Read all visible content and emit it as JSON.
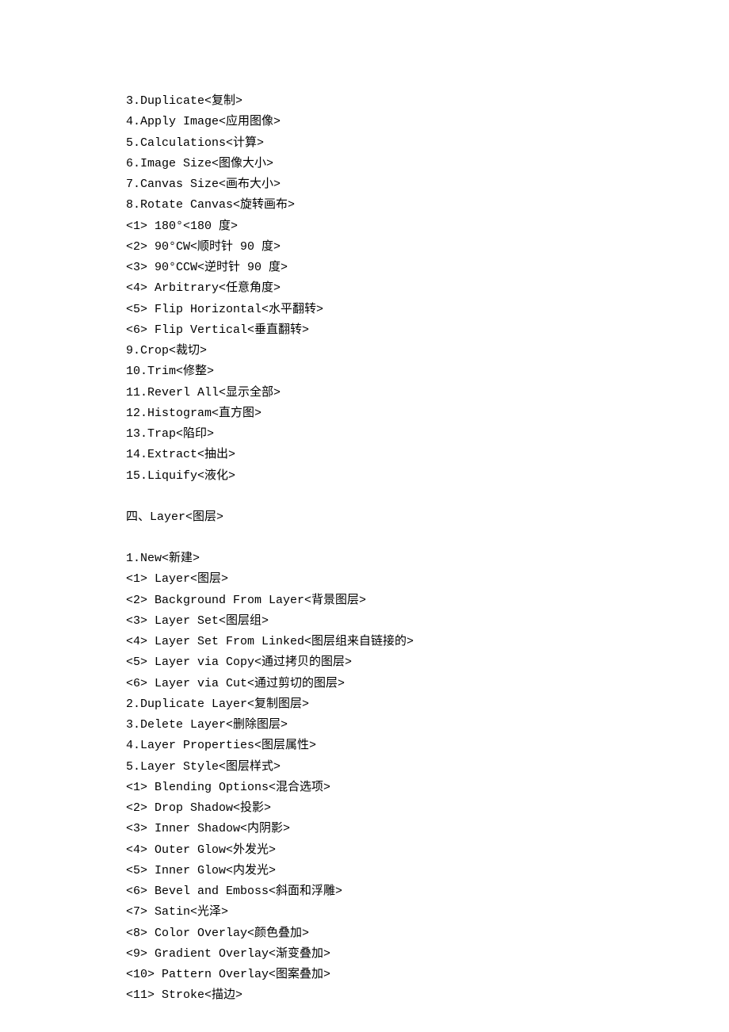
{
  "lines": [
    "3.Duplicate<复制>",
    "4.Apply Image<应用图像>",
    "5.Calculations<计算>",
    "6.Image Size<图像大小>",
    "7.Canvas Size<画布大小>",
    "8.Rotate Canvas<旋转画布>",
    "<1> 180°<180 度>",
    "<2> 90°CW<顺时针 90 度>",
    "<3> 90°CCW<逆时针 90 度>",
    "<4> Arbitrary<任意角度>",
    "<5> Flip Horizontal<水平翻转>",
    "<6> Flip Vertical<垂直翻转>",
    "9.Crop<裁切>",
    "10.Trim<修整>",
    "11.Reverl All<显示全部>",
    "12.Histogram<直方图>",
    "13.Trap<陷印>",
    "14.Extract<抽出>",
    "15.Liquify<液化>",
    "",
    "四、Layer<图层>",
    "",
    "1.New<新建>",
    "<1> Layer<图层>",
    "<2> Background From Layer<背景图层>",
    "<3> Layer Set<图层组>",
    "<4> Layer Set From Linked<图层组来自链接的>",
    "<5> Layer via Copy<通过拷贝的图层>",
    "<6> Layer via Cut<通过剪切的图层>",
    "2.Duplicate Layer<复制图层>",
    "3.Delete Layer<删除图层>",
    "4.Layer Properties<图层属性>",
    "5.Layer Style<图层样式>",
    "<1> Blending Options<混合选项>",
    "<2> Drop Shadow<投影>",
    "<3> Inner Shadow<内阴影>",
    "<4> Outer Glow<外发光>",
    "<5> Inner Glow<内发光>",
    "<6> Bevel and Emboss<斜面和浮雕>",
    "<7> Satin<光泽>",
    "<8> Color Overlay<颜色叠加>",
    "<9> Gradient Overlay<渐变叠加>",
    "<10> Pattern Overlay<图案叠加>",
    "<11> Stroke<描边>"
  ]
}
